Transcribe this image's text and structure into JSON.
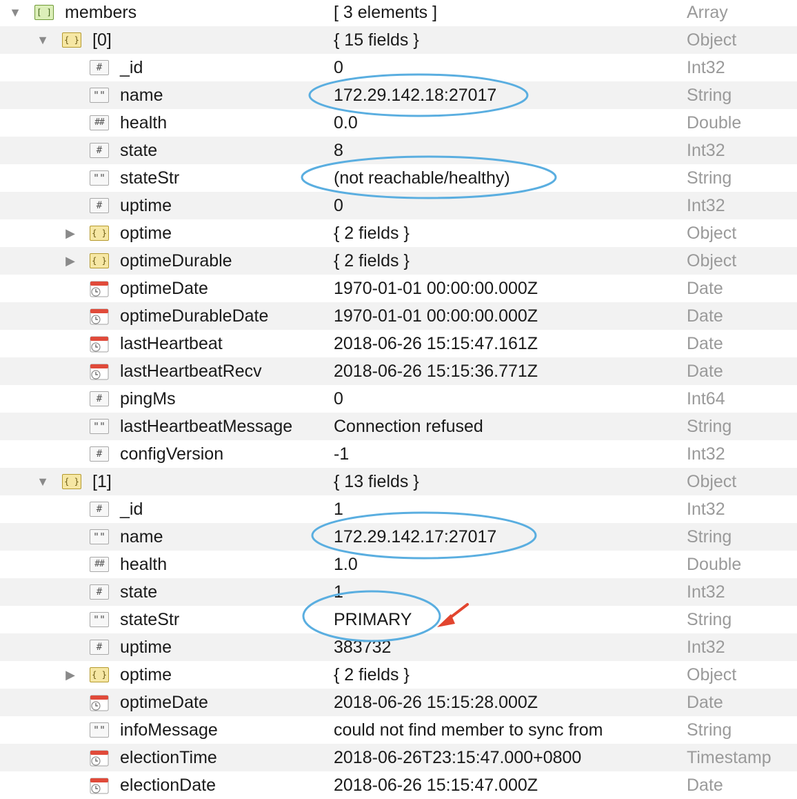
{
  "tree": {
    "rows": [
      {
        "key": "members",
        "value": "[ 3 elements ]",
        "type": "Array"
      },
      {
        "key": "[0]",
        "value": "{ 15 fields }",
        "type": "Object"
      },
      {
        "key": "_id",
        "value": "0",
        "type": "Int32"
      },
      {
        "key": "name",
        "value": "172.29.142.18:27017",
        "type": "String"
      },
      {
        "key": "health",
        "value": "0.0",
        "type": "Double"
      },
      {
        "key": "state",
        "value": "8",
        "type": "Int32"
      },
      {
        "key": "stateStr",
        "value": "(not reachable/healthy)",
        "type": "String"
      },
      {
        "key": "uptime",
        "value": "0",
        "type": "Int32"
      },
      {
        "key": "optime",
        "value": "{ 2 fields }",
        "type": "Object"
      },
      {
        "key": "optimeDurable",
        "value": "{ 2 fields }",
        "type": "Object"
      },
      {
        "key": "optimeDate",
        "value": "1970-01-01 00:00:00.000Z",
        "type": "Date"
      },
      {
        "key": "optimeDurableDate",
        "value": "1970-01-01 00:00:00.000Z",
        "type": "Date"
      },
      {
        "key": "lastHeartbeat",
        "value": "2018-06-26 15:15:47.161Z",
        "type": "Date"
      },
      {
        "key": "lastHeartbeatRecv",
        "value": "2018-06-26 15:15:36.771Z",
        "type": "Date"
      },
      {
        "key": "pingMs",
        "value": "0",
        "type": "Int64"
      },
      {
        "key": "lastHeartbeatMessage",
        "value": "Connection refused",
        "type": "String"
      },
      {
        "key": "configVersion",
        "value": "-1",
        "type": "Int32"
      },
      {
        "key": "[1]",
        "value": "{ 13 fields }",
        "type": "Object"
      },
      {
        "key": "_id",
        "value": "1",
        "type": "Int32"
      },
      {
        "key": "name",
        "value": "172.29.142.17:27017",
        "type": "String"
      },
      {
        "key": "health",
        "value": "1.0",
        "type": "Double"
      },
      {
        "key": "state",
        "value": "1",
        "type": "Int32"
      },
      {
        "key": "stateStr",
        "value": "PRIMARY",
        "type": "String"
      },
      {
        "key": "uptime",
        "value": "383732",
        "type": "Int32"
      },
      {
        "key": "optime",
        "value": "{ 2 fields }",
        "type": "Object"
      },
      {
        "key": "optimeDate",
        "value": "2018-06-26 15:15:28.000Z",
        "type": "Date"
      },
      {
        "key": "infoMessage",
        "value": "could not find member to sync from",
        "type": "String"
      },
      {
        "key": "electionTime",
        "value": "2018-06-26T23:15:47.000+0800",
        "type": "Timestamp"
      },
      {
        "key": "electionDate",
        "value": "2018-06-26 15:15:47.000Z",
        "type": "Date"
      }
    ]
  },
  "annotations": {
    "ellipse_color": "#5aaee0",
    "arrow_color": "#e2452f"
  }
}
